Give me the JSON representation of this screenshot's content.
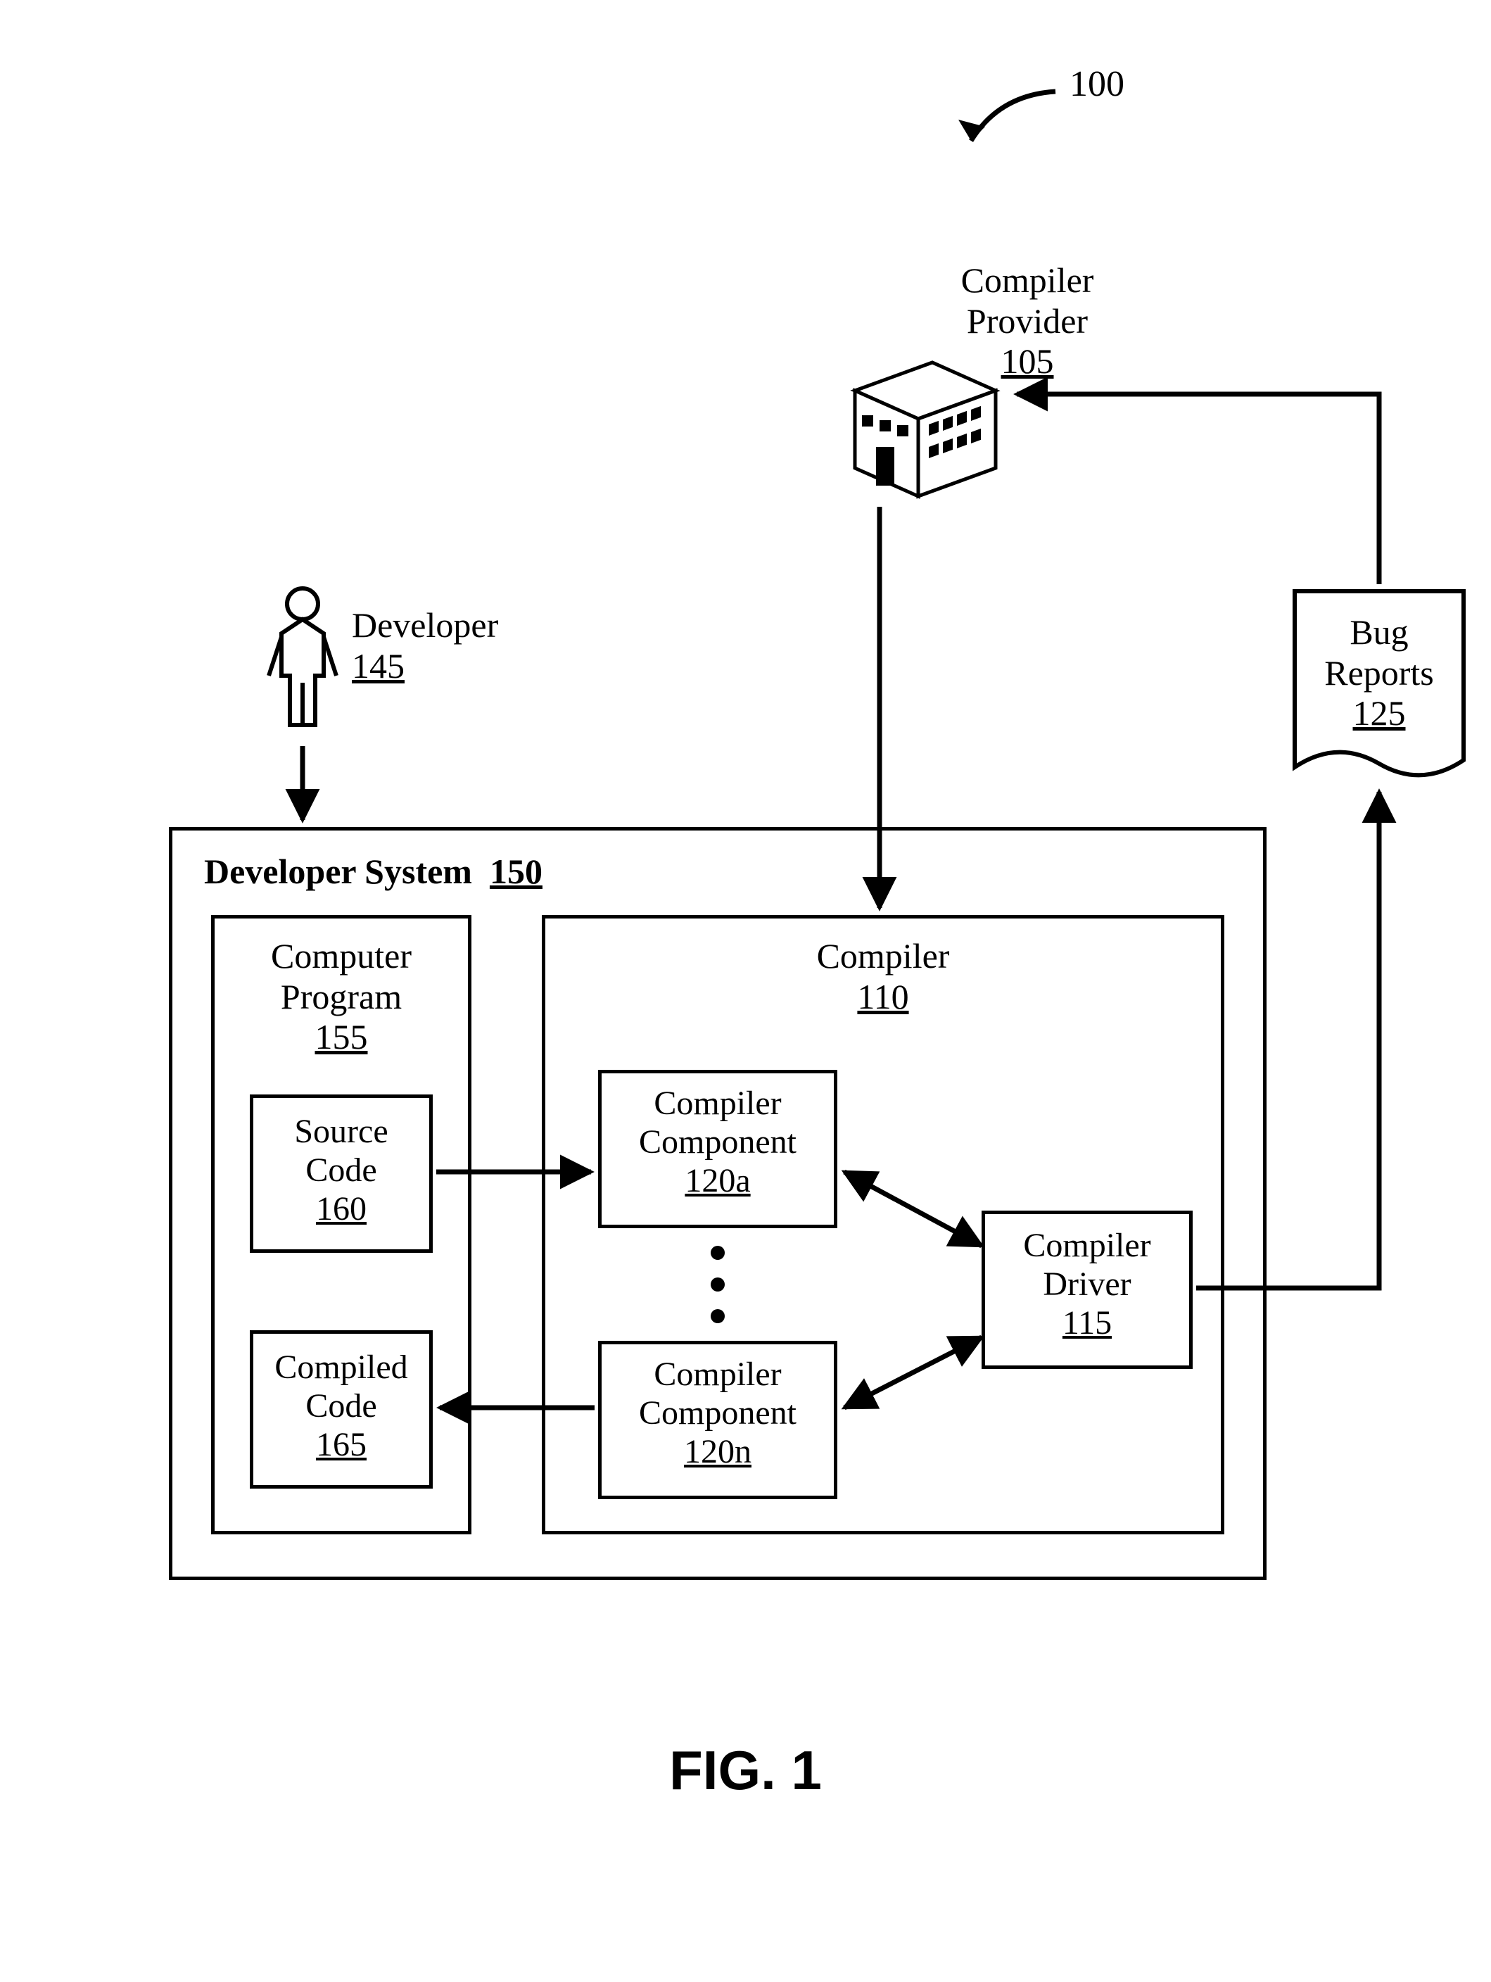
{
  "figure_number": "100",
  "figure_caption": "FIG. 1",
  "compiler_provider": {
    "label": "Compiler\nProvider",
    "ref": "105"
  },
  "developer": {
    "label": "Developer",
    "ref": "145"
  },
  "developer_system": {
    "label": "Developer System",
    "ref": "150"
  },
  "computer_program": {
    "label": "Computer\nProgram",
    "ref": "155"
  },
  "source_code": {
    "label": "Source\nCode",
    "ref": "160"
  },
  "compiled_code": {
    "label": "Compiled\nCode",
    "ref": "165"
  },
  "compiler": {
    "label": "Compiler",
    "ref": "110"
  },
  "compiler_component_a": {
    "label": "Compiler\nComponent",
    "ref": "120a"
  },
  "compiler_component_n": {
    "label": "Compiler\nComponent",
    "ref": "120n"
  },
  "compiler_driver": {
    "label": "Compiler\nDriver",
    "ref": "115"
  },
  "bug_reports": {
    "label": "Bug\nReports",
    "ref": "125"
  }
}
